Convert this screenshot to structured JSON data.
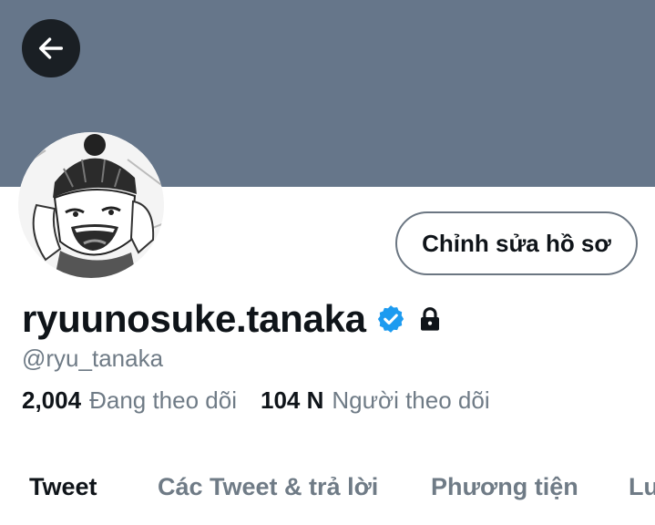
{
  "header": {
    "banner_color": "#66768a",
    "back_icon": "arrow-left-icon"
  },
  "profile": {
    "avatar_icon": "avatar",
    "display_name": "ryuunosuke.tanaka",
    "verified_icon": "verified-badge-icon",
    "verified_color": "#1d9bf0",
    "protected_icon": "lock-icon",
    "handle": "@ryu_tanaka",
    "edit_button_label": "Chỉnh sửa hồ sơ"
  },
  "stats": {
    "following_count": "2,004",
    "following_label": "Đang theo dõi",
    "followers_count": "104 N",
    "followers_label": "Người theo dõi"
  },
  "tabs": [
    {
      "label": "Tweet",
      "active": true
    },
    {
      "label": "Các Tweet & trả lời",
      "active": false
    },
    {
      "label": "Phương tiện",
      "active": false
    },
    {
      "label": "Lượt thích",
      "active": false
    }
  ]
}
